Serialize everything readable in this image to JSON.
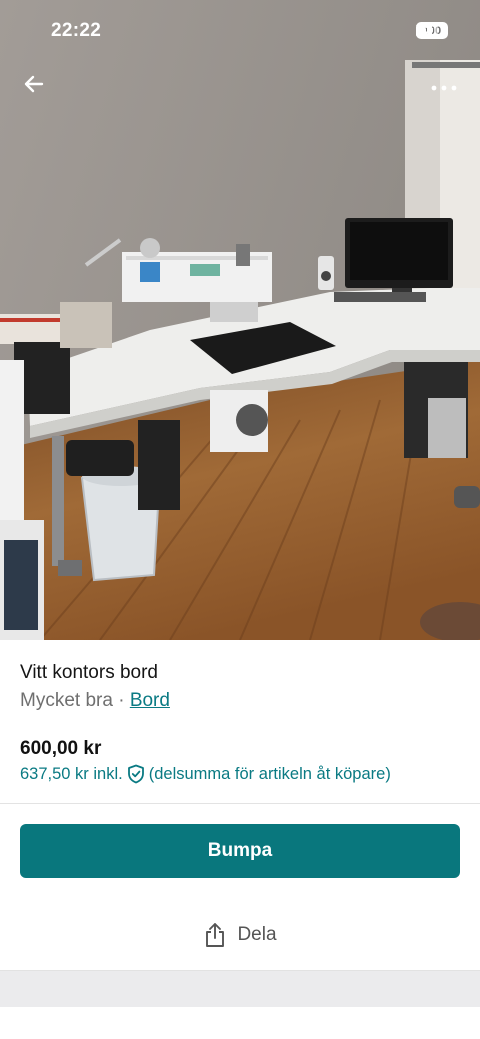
{
  "status_bar": {
    "time": "22:22",
    "battery": "100"
  },
  "listing": {
    "title": "Vitt kontors bord",
    "condition": "Mycket bra",
    "separator": "·",
    "category": "Bord",
    "price": "600,00 kr",
    "price_incl": "637,50 kr inkl.",
    "price_note": "(delsumma för artikeln åt köpare)"
  },
  "actions": {
    "primary_label": "Bumpa",
    "share_label": "Dela"
  },
  "colors": {
    "accent": "#09777d",
    "link": "#0a7a83"
  }
}
